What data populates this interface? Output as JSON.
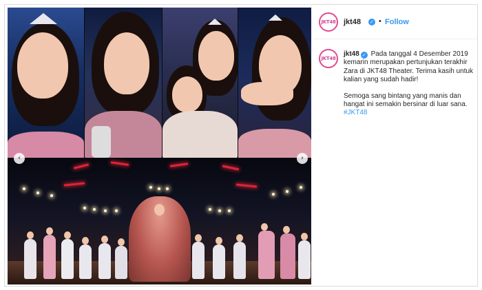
{
  "post": {
    "account": {
      "username": "jkt48",
      "avatar_text": "JKT48",
      "verified": true,
      "follow_label": "Follow",
      "separator": "•"
    },
    "caption": {
      "username": "jkt48",
      "paragraph1": "Pada tanggal 4 Desember 2019 kemarin merupakan pertunjukan terakhir Zara di JKT48 Theater. Terima kasih untuk kalian yang sudah hadir!",
      "paragraph2_text": "Semoga sang bintang yang manis dan hangat ini semakin bersinar di luar sana.",
      "hashtag": "#JKT48"
    },
    "media": {
      "prev_icon": "chevron-left-icon",
      "next_icon": "chevron-right-icon",
      "prev_glyph": "‹",
      "next_glyph": "›"
    },
    "colors": {
      "accent_blue": "#3897f0",
      "avatar_ring": "#e04b8f",
      "border": "#dbdbdb"
    }
  }
}
